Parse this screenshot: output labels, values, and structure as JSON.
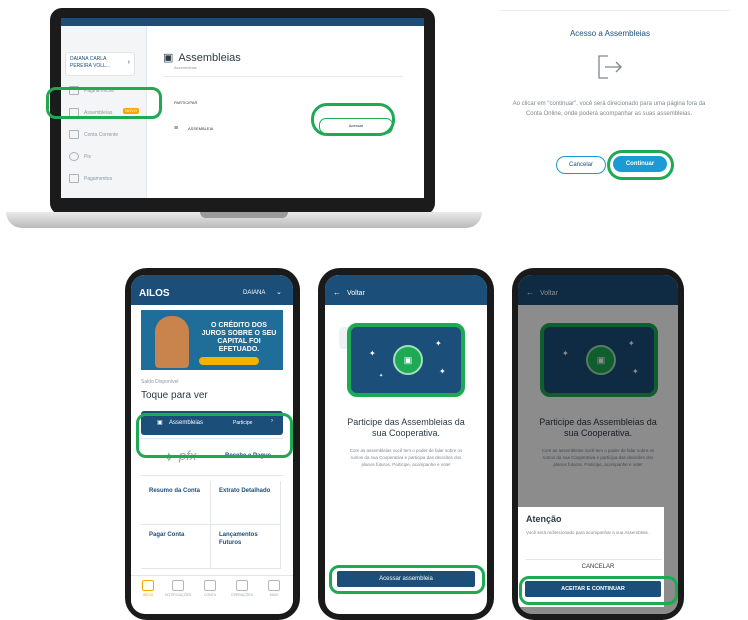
{
  "colors": {
    "brand_blue": "#1c4e7a",
    "accent_green": "#1eaa55",
    "button_blue": "#1c9ad6"
  },
  "laptop": {
    "user_name_line1": "DAIANA CARLA",
    "user_name_line2": "PEREIRA VOLL...",
    "nav": {
      "home": "Página Inicial",
      "assemblies": "Assembleias",
      "current_account": "Conta Corrente",
      "pix": "Pix",
      "payments": "Pagamentos"
    },
    "nav_badge": "NOVO",
    "page_title": "Assembleias",
    "page_subtitle": "Assembleias",
    "section_label": "PARTICIPAR",
    "row_text": "ASSEMBLEIA",
    "row_button": "Acessar"
  },
  "dialog": {
    "title": "Acesso a Assembleias",
    "icon": "exit-icon",
    "text": "Ao clicar em \"continuar\", você será direcionado para uma página fora da Conta Online, onde poderá acompanhar as suas assembleias.",
    "cancel": "Cancelar",
    "continue": "Continuar"
  },
  "phone1": {
    "logo": "AILOS",
    "user": "DAIANA",
    "banner_text": "O CRÉDITO DOS JUROS SOBRE O SEU CAPITAL FOI EFETUADO.",
    "banner_pill": "",
    "balance_label": "Saldo Disponível",
    "balance_value": "Toque para ver",
    "assemblies_label": "Assembleias",
    "assemblies_action": "Participe",
    "partner_logo": "pfx",
    "partner_label": "Recebe e Pague",
    "tiles": [
      "Resumo da Conta",
      "Extrato Detalhado",
      "Pagar Conta",
      "Lançamentos Futuros"
    ],
    "bottom_nav": [
      "INÍCIO",
      "NOTIFICAÇÕES",
      "CONTA",
      "OPERAÇÕES",
      "MAIS"
    ]
  },
  "phone2": {
    "back": "Voltar",
    "title": "Participe das Assembleias da sua Cooperativa.",
    "body": "Com as assembleias você tem o poder de falar sobre os rumos da sua Cooperativa e participa das decisões dos planos futuros. Participe, acompanhe e vote!",
    "button": "Acessar assembleia"
  },
  "phone3": {
    "back": "Voltar",
    "title": "Participe das Assembleias da sua Cooperativa.",
    "body": "Com as assembleias você tem o poder de falar sobre os rumos da sua Cooperativa e participa das decisões dos planos futuros. Participe, acompanhe e vote!",
    "sheet_title": "Atenção",
    "sheet_text": "Você será redirecionado para acompanhar a sua Assembleia.",
    "cancel": "CANCELAR",
    "confirm": "ACEITAR E CONTINUAR"
  }
}
